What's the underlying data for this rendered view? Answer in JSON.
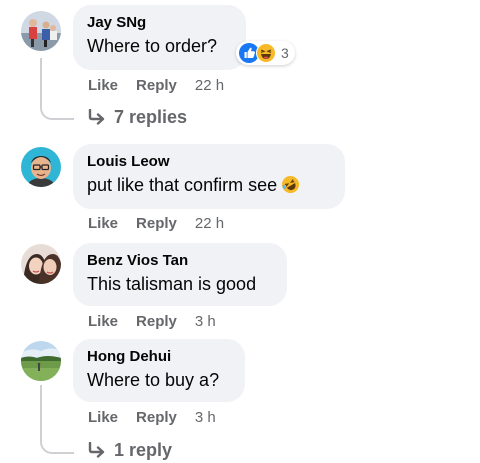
{
  "comments": [
    {
      "author": "Jay SNg",
      "text": "Where to order?",
      "reactions": {
        "icons": [
          "like-icon",
          "haha-icon"
        ],
        "count": "3"
      },
      "actions": {
        "like": "Like",
        "reply": "Reply",
        "time": "22 h"
      },
      "replies_label": "7 replies"
    },
    {
      "author": "Louis Leow",
      "text": "put like that confirm see",
      "emoji": "rofl-emoji",
      "actions": {
        "like": "Like",
        "reply": "Reply",
        "time": "22 h"
      }
    },
    {
      "author": "Benz Vios Tan",
      "text": "This talisman is good",
      "actions": {
        "like": "Like",
        "reply": "Reply",
        "time": "3 h"
      }
    },
    {
      "author": "Hong Dehui",
      "text": "Where to buy a?",
      "actions": {
        "like": "Like",
        "reply": "Reply",
        "time": "3 h"
      },
      "replies_label": "1 reply"
    }
  ],
  "colors": {
    "bubble": "#f0f2f5",
    "secondary_text": "#65676b",
    "like_blue": "#1877f2",
    "haha_yellow": "#f7b928"
  }
}
